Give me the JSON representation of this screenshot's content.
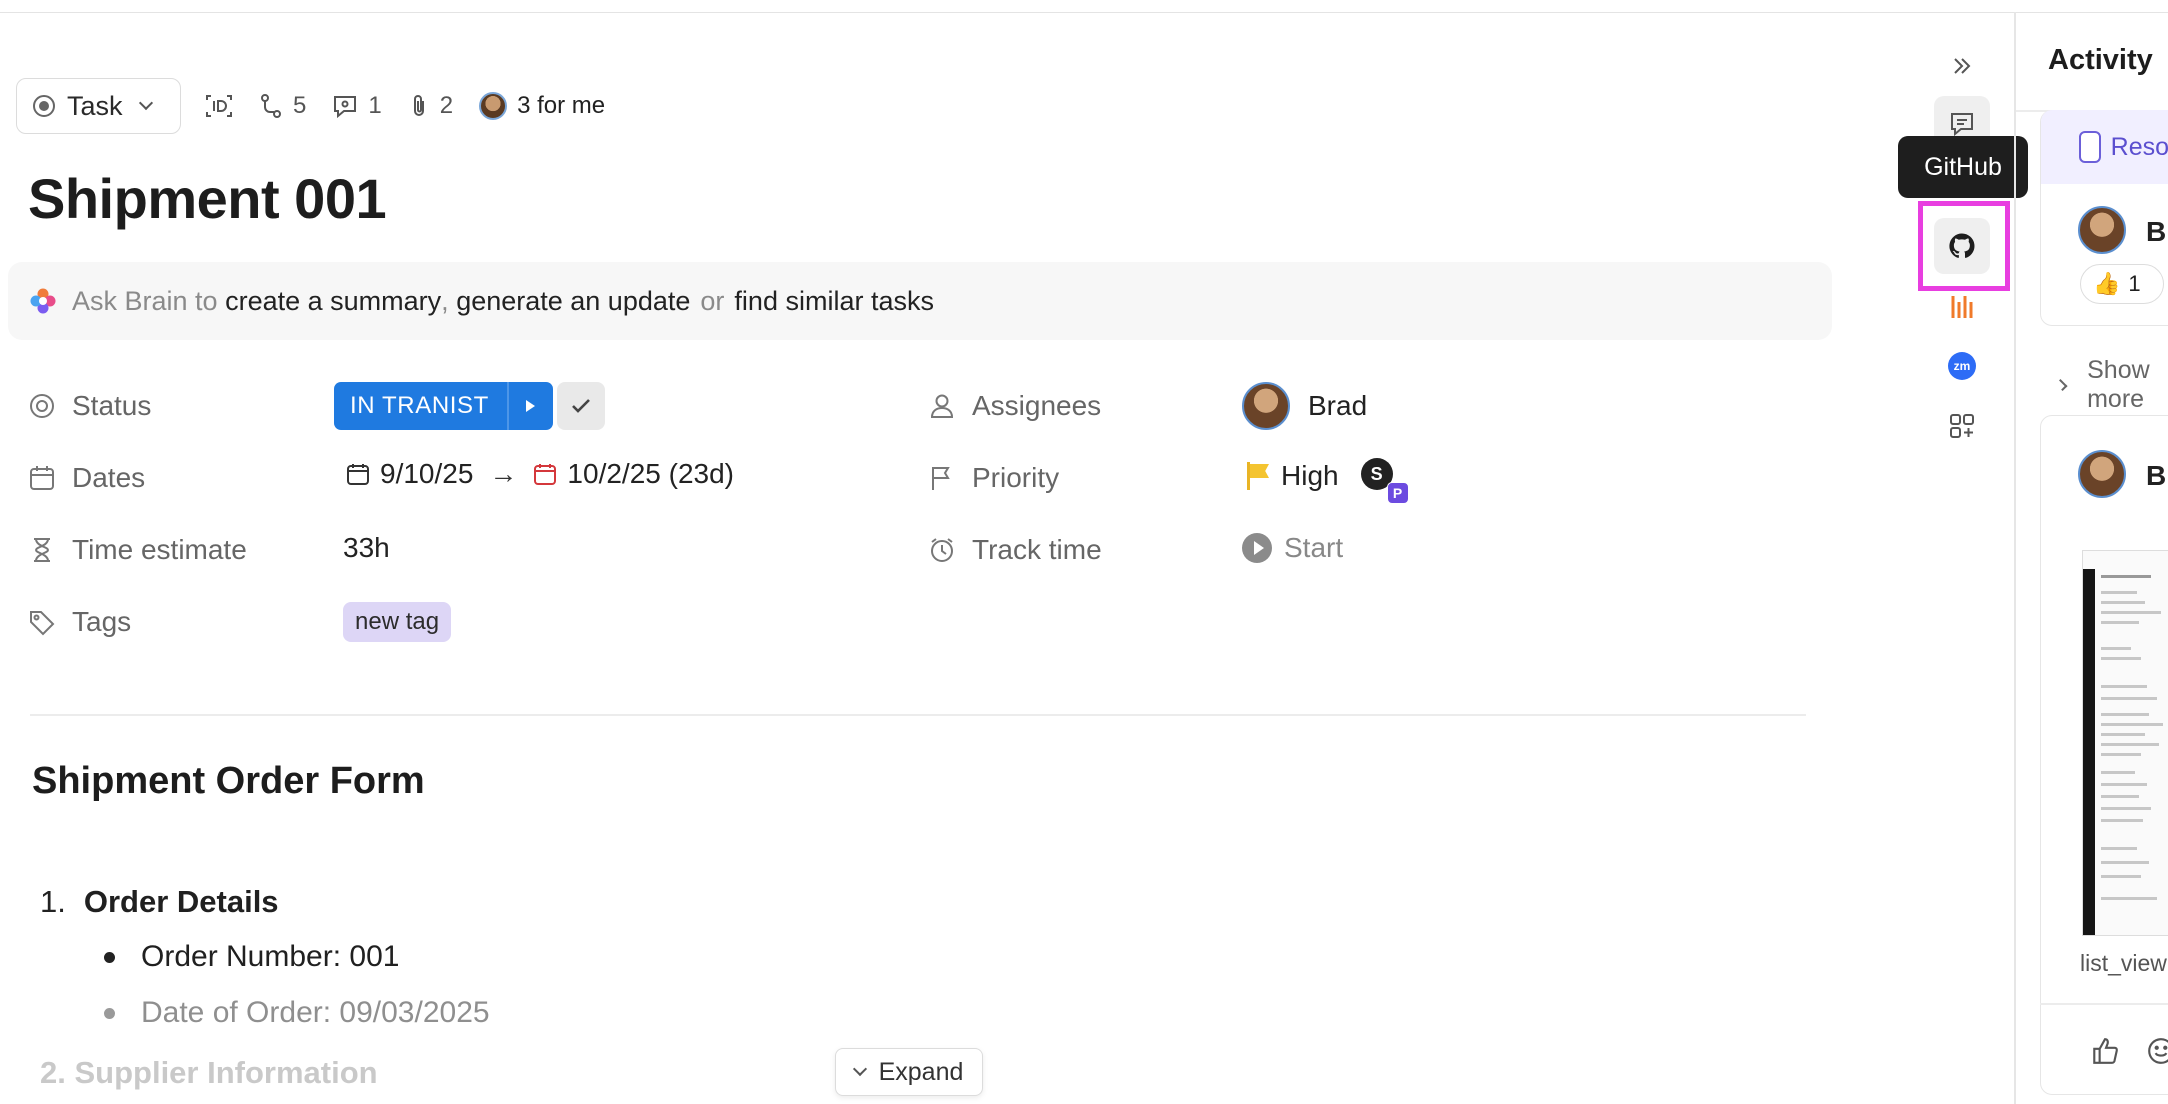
{
  "toolbar": {
    "task_type": "Task",
    "subtasks_count": "5",
    "comments_count": "1",
    "attachments_count": "2",
    "assigned_to_me": "3 for me"
  },
  "task": {
    "title": "Shipment 001"
  },
  "brain": {
    "prefix": "Ask Brain to",
    "action1": "create a summary",
    "sep1": ",",
    "action2": "generate an update",
    "sep2": "or",
    "action3": "find similar tasks"
  },
  "fields": {
    "status": {
      "label": "Status",
      "value": "IN TRANIST"
    },
    "dates": {
      "label": "Dates",
      "start": "9/10/25",
      "end": "10/2/25 (23d)"
    },
    "time_estimate": {
      "label": "Time estimate",
      "value": "33h"
    },
    "tags": {
      "label": "Tags",
      "value": "new tag"
    },
    "assignees": {
      "label": "Assignees",
      "value": "Brad"
    },
    "priority": {
      "label": "Priority",
      "value": "High",
      "badge_initial": "S",
      "badge_sub": "P"
    },
    "track_time": {
      "label": "Track time",
      "value": "Start"
    }
  },
  "description": {
    "heading": "Shipment Order Form",
    "section1_number": "1.",
    "section1_title": "Order Details",
    "items": [
      "Order Number: 001",
      "Date of Order: 09/03/2025"
    ],
    "next_section": "2.  Supplier Information"
  },
  "expand_label": "Expand",
  "rail": {
    "tooltip": "GitHub",
    "zoom_badge": "zm"
  },
  "activity": {
    "title": "Activity",
    "resolve_label": "Resolve",
    "comment_author": "Brad",
    "reaction_count": "1",
    "show_more": "Show more",
    "attachment_author": "Brad",
    "attachment_name": "list_view"
  },
  "colors": {
    "status_blue": "#1f7ae0",
    "tag_purple": "#ddd6f6",
    "highlight_magenta": "#e83ee0",
    "priority_yellow": "#f4c430"
  }
}
